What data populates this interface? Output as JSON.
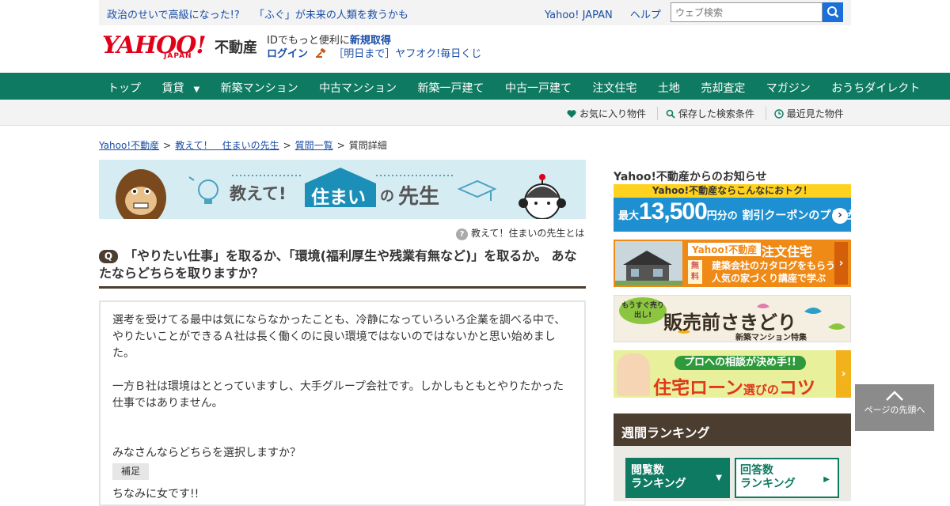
{
  "topbar": {
    "news": [
      "政治のせいで高級になった!?",
      "「ふぐ」が未来の人類を救うかも"
    ],
    "links": [
      "Yahoo! JAPAN",
      "ヘルプ"
    ],
    "search_placeholder": "ウェブ検索"
  },
  "header": {
    "logo_text": "YAHOO!",
    "logo_sub": "JAPAN",
    "logo_service": "不動産",
    "member_line": "IDでもっと便利に",
    "signup": "新規取得",
    "login": "ログイン",
    "auction": "［明日まで］ヤフオク!毎日くじ"
  },
  "nav": {
    "items": [
      "トップ",
      "賃貸",
      "新築マンション",
      "中古マンション",
      "新築一戸建て",
      "中古一戸建て",
      "注文住宅",
      "土地",
      "売却査定",
      "マガジン",
      "おうちダイレクト"
    ],
    "dropdown_caret": "▼",
    "sub": [
      "お気に入り物件",
      "保存した検索条件",
      "最近見た物件"
    ]
  },
  "breadcrumb": {
    "items": [
      "Yahoo!不動産",
      "教えて！　住まいの先生",
      "質問一覧",
      "質問詳細"
    ],
    "sep": ">"
  },
  "banner": {
    "part1": "教えて!",
    "part2": "住まい",
    "part3": "の",
    "part4": "先生",
    "about": "教えて！住まいの先生とは",
    "q_icon": "?"
  },
  "question": {
    "badge": "Q",
    "title": "「やりたい仕事」を取るか、「環境(福利厚生や残業有無など)」を取るか。 あなたならどちらを取りますか？",
    "body1": "選考を受けてる最中は気にならなかったことも、冷静になっていろいろ企業を調べる中で、やりたいことができるＡ社は長く働くのに良い環境ではないのではないかと思い始めました。",
    "body2": "一方Ｂ社は環境はととっていますし、大手グループ会社です。しかしもともとやりたかった仕事ではありません。",
    "body3": "みなさんならどちらを選択しますか？",
    "supplement_label": "補足",
    "body4": "ちなみに女です!!"
  },
  "sidebar": {
    "news_heading": "Yahoo!不動産からのお知らせ",
    "ad1_strip": "Yahoo!不動産ならこんなにおトク！",
    "ad1_prefix": "最大",
    "ad1_amount": "13,500",
    "ad1_unit": "円分の",
    "ad1_text": "割引クーポンのプレゼント",
    "ad2_label": "Yahoo!不動産",
    "ad2_title": "注文住宅",
    "ad2_free": "無料",
    "ad2_desc1": "建築会社のカタログをもらう",
    "ad2_desc2": "人気の家づくり講座で学ぶ",
    "ad3_soon": "もうすぐ売り出し!",
    "ad3_title": "販売前",
    "ad3_title2": "さきどり",
    "ad3_sub": "新築マンション特集",
    "ad4_pill": "プロへの相談が決め手!!",
    "ad4_title": "住宅ローン",
    "ad4_small": "選びの",
    "ad4_end": "コツ",
    "arrow": "›",
    "ranking_heading": "週間ランキング",
    "tab1_line1": "閲覧数",
    "tab1_line2": "ランキング",
    "tab2_line1": "回答数",
    "tab2_line2": "ランキング",
    "caret_down": "▼",
    "caret_right": "▶"
  },
  "back_to_top": "ページの先頭へ",
  "colors": {
    "nav_green": "#0f7a62",
    "brand_red": "#e0001a",
    "link_blue": "#1a4ea6",
    "heading_brown": "#4b3d2f"
  }
}
